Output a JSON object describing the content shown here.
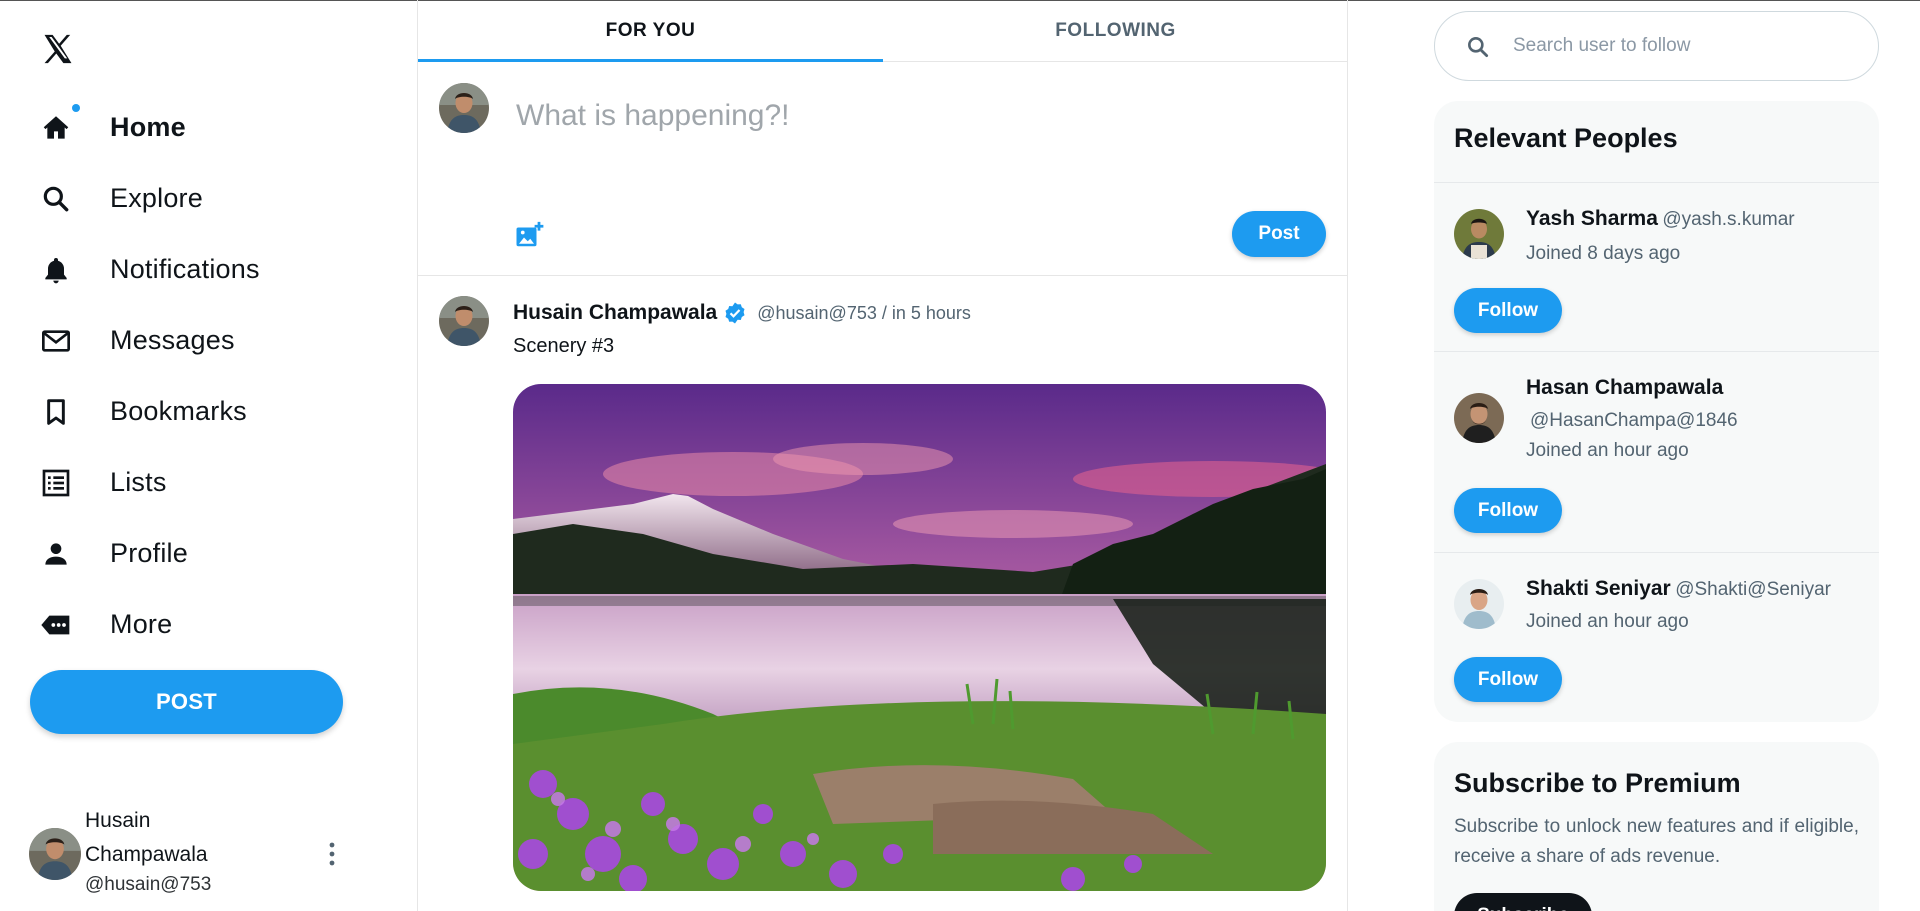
{
  "app": {
    "logo": "x-logo"
  },
  "nav": {
    "items": [
      {
        "label": "Home",
        "icon": "home-icon",
        "active": true,
        "has_notification_dot": true
      },
      {
        "label": "Explore",
        "icon": "search-icon"
      },
      {
        "label": "Notifications",
        "icon": "bell-icon"
      },
      {
        "label": "Messages",
        "icon": "mail-icon"
      },
      {
        "label": "Bookmarks",
        "icon": "bookmark-icon"
      },
      {
        "label": "Lists",
        "icon": "list-icon"
      },
      {
        "label": "Profile",
        "icon": "person-icon"
      },
      {
        "label": "More",
        "icon": "more-icon"
      }
    ],
    "post_label": "POST"
  },
  "current_user": {
    "name": "Husain Champawala",
    "handle": "@husain@753"
  },
  "feed": {
    "tabs": [
      {
        "label": "FOR YOU",
        "active": true
      },
      {
        "label": "FOLLOWING",
        "active": false
      }
    ],
    "composer": {
      "placeholder": "What is happening?!",
      "post_label": "Post"
    },
    "tweet": {
      "author": "Husain Champawala",
      "verified": true,
      "meta": "@husain@753 / in 5 hours",
      "text": "Scenery #3",
      "image_alt": "Mountain lake scenery with pink sky and purple flowers"
    }
  },
  "search": {
    "placeholder": "Search user to follow"
  },
  "relevant_people": {
    "title": "Relevant Peoples",
    "follow_label": "Follow",
    "people": [
      {
        "name": "Yash Sharma",
        "handle": "@yash.s.kumar",
        "joined": "Joined 8 days ago"
      },
      {
        "name": "Hasan Champawala",
        "handle": "@HasanChampa@1846",
        "joined": "Joined an hour ago"
      },
      {
        "name": "Shakti Seniyar",
        "handle": "@Shakti@Seniyar",
        "joined": "Joined an hour ago"
      }
    ]
  },
  "premium": {
    "title": "Subscribe to Premium",
    "description": "Subscribe to unlock new features and if eligible, receive a share of ads revenue.",
    "button_label": "Subscribe"
  },
  "colors": {
    "accent": "#1d9bf0",
    "text": "#0f1419",
    "muted": "#536471",
    "card_bg": "#f7f9f9"
  }
}
